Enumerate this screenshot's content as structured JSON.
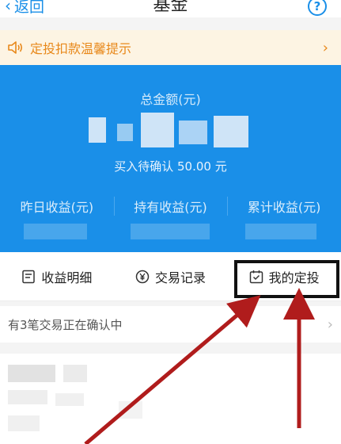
{
  "nav": {
    "back_label": "返回",
    "title": "基金",
    "help_glyph": "?"
  },
  "notice": {
    "text": "定投扣款温馨提示",
    "arrow": "›",
    "icon": "speaker-icon"
  },
  "summary": {
    "total_label": "总金额(元)",
    "pending_text": "买入待确认 50.00 元",
    "yesterday_label": "昨日收益(元)",
    "holding_label": "持有收益(元)",
    "cumulative_label": "累计收益(元)"
  },
  "actions": [
    {
      "label": "收益明细",
      "icon": "list-document-icon"
    },
    {
      "label": "交易记录",
      "icon": "yen-circle-icon"
    },
    {
      "label": "我的定投",
      "icon": "calendar-check-icon"
    }
  ],
  "confirm_row": {
    "text": "有3笔交易正在确认中",
    "arrow": "›"
  },
  "colors": {
    "accent": "#1a8fe8",
    "notice_bg": "#fdf4e3",
    "notice_text": "#e8881a",
    "annotation_arrow": "#b01c1c"
  }
}
